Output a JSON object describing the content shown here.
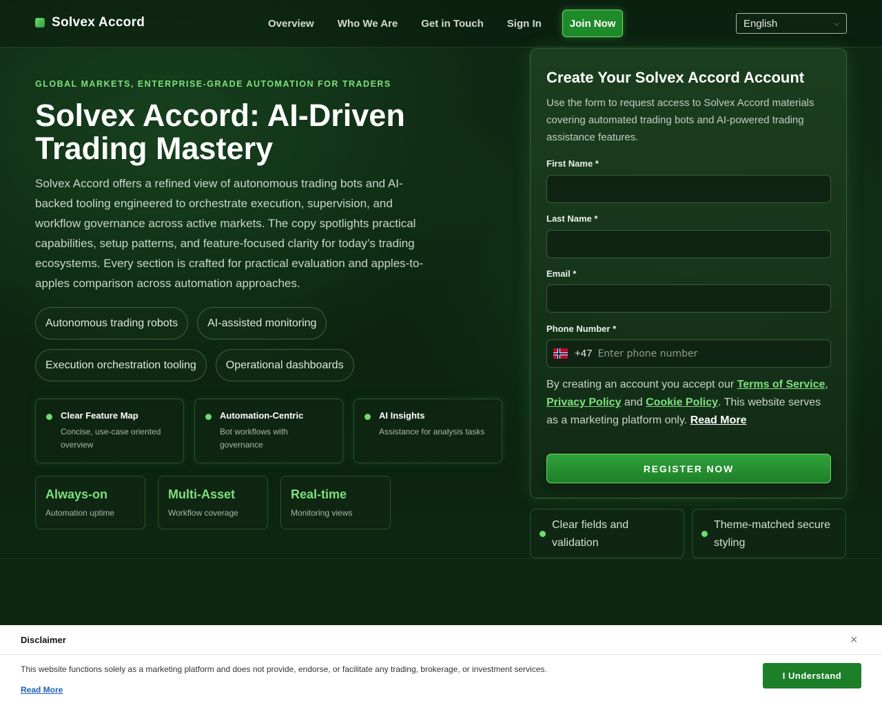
{
  "header": {
    "brand": "Solvex Accord",
    "nav": [
      "Overview",
      "Who We Are",
      "Get in Touch",
      "Sign In"
    ],
    "join_label": "Join Now",
    "language": "English"
  },
  "hero": {
    "eyebrow": "GLOBAL MARKETS, ENTERPRISE-GRADE AUTOMATION FOR TRADERS",
    "title": "Solvex Accord: AI-Driven Trading Mastery",
    "description": "Solvex Accord offers a refined view of autonomous trading bots and AI-backed tooling engineered to orchestrate execution, supervision, and workflow governance across active markets. The copy spotlights practical capabilities, setup patterns, and feature-focused clarity for today’s trading ecosystems. Every section is crafted for practical evaluation and apples-to-apples comparison across automation approaches.",
    "chips": [
      "Autonomous trading robots",
      "AI-assisted monitoring",
      "Execution orchestration tooling",
      "Operational dashboards"
    ],
    "features": [
      {
        "title": "Clear Feature Map",
        "sub": "Concise, use-case oriented overview"
      },
      {
        "title": "Automation-Centric",
        "sub": "Bot workflows with governance"
      },
      {
        "title": "AI Insights",
        "sub": "Assistance for analysis tasks"
      }
    ],
    "stats": [
      {
        "value": "Always-on",
        "label": "Automation uptime"
      },
      {
        "value": "Multi-Asset",
        "label": "Workflow coverage"
      },
      {
        "value": "Real-time",
        "label": "Monitoring views"
      }
    ]
  },
  "form": {
    "title": "Create Your Solvex Accord Account",
    "description": "Use the form to request access to Solvex Accord materials covering automated trading bots and AI-powered trading assistance features.",
    "first_name_label": "First Name *",
    "first_name_value": "",
    "last_name_label": "Last Name *",
    "last_name_value": "",
    "email_label": "Email *",
    "email_value": "",
    "phone_label": "Phone Number *",
    "dial_code": "+47",
    "phone_placeholder": "Enter phone number",
    "terms_prefix": "By creating an account you accept our",
    "terms_link": "Terms of Service",
    "comma": ",",
    "privacy_link": "Privacy Policy",
    "and": "and",
    "cookie_link": "Cookie Policy",
    "terms_suffix": ". This website serves as a marketing platform only.",
    "read_more": "Read More",
    "submit": "REGISTER NOW"
  },
  "badges": [
    "Clear fields and validation",
    "Theme-matched secure styling"
  ],
  "disclaimer": {
    "title": "Disclaimer",
    "close_glyph": "×",
    "text": "This website functions solely as a marketing platform and does not provide, endorse, or facilitate any trading, brokerage, or investment services.",
    "read_more": "Read More",
    "button": "I Understand"
  }
}
